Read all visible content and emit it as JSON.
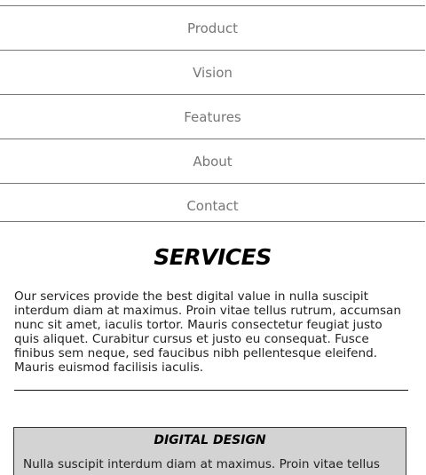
{
  "nav": {
    "items": [
      {
        "label": "Product"
      },
      {
        "label": "Vision"
      },
      {
        "label": "Features"
      },
      {
        "label": "About"
      },
      {
        "label": "Contact"
      }
    ]
  },
  "services": {
    "title": "SERVICES",
    "intro": "Our services provide the best digital value in nulla suscipit interdum diam at maximus. Proin vitae tellus rutrum, accumsan nunc sit amet, iaculis tortor. Mauris consectetur feugiat justo quis aliquet. Curabitur cursus et justo eu consequat. Fusce finibus sem neque, sed faucibus nibh pellentesque eleifend. Mauris euismod facilisis iaculis.",
    "cards": [
      {
        "title": "DIGITAL DESIGN",
        "text": "Nulla suscipit interdum diam at maximus. Proin vitae tellus"
      }
    ]
  }
}
